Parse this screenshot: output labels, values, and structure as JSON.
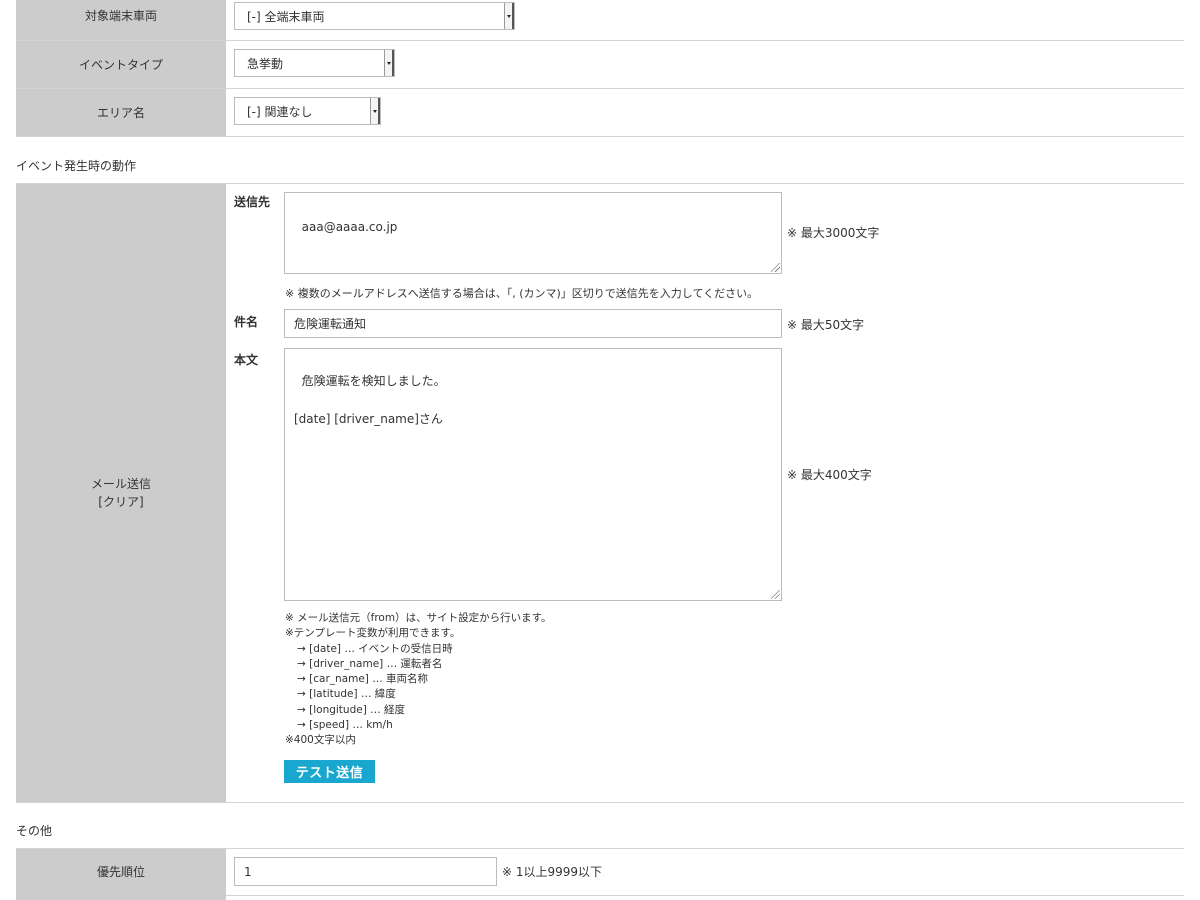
{
  "target": {
    "label": "対象端末車両",
    "value": "[-] 全端末車両"
  },
  "event_type": {
    "label": "イベントタイプ",
    "value": "急挙動"
  },
  "area": {
    "label": "エリア名",
    "value": "[-] 関連なし"
  },
  "section_action": "イベント発生時の動作",
  "mail": {
    "label_line1": "メール送信",
    "label_line2": "[クリア]",
    "to_label": "送信先",
    "to_value": "aaa@aaaa.co.jp",
    "to_limit": "※ 最大3000文字",
    "to_note": "※ 複数のメールアドレスへ送信する場合は、「, (カンマ)」区切りで送信先を入力してください。",
    "subject_label": "件名",
    "subject_value": "危険運転通知",
    "subject_limit": "※ 最大50文字",
    "body_label": "本文",
    "body_value": "危険運転を検知しました。\n\n[date] [driver_name]さん",
    "body_limit": "※ 最大400文字",
    "notes": [
      "※ メール送信元（from）は、サイト設定から行います。",
      "※テンプレート変数が利用できます。",
      "→ [date] … イベントの受信日時",
      "→ [driver_name] … 運転者名",
      "→ [car_name] … 車両名称",
      "→ [latitude] … 緯度",
      "→ [longitude] … 経度",
      "→ [speed] … km/h",
      "※400文字以内"
    ],
    "test_button": "テスト送信"
  },
  "section_other": "その他",
  "priority": {
    "label": "優先順位",
    "value": "1",
    "limit": "※ 1以上9999以下"
  },
  "colors": {
    "label_bg": "#cccccc",
    "button_bg": "#1aa7cf",
    "border": "#d3d3d3"
  }
}
